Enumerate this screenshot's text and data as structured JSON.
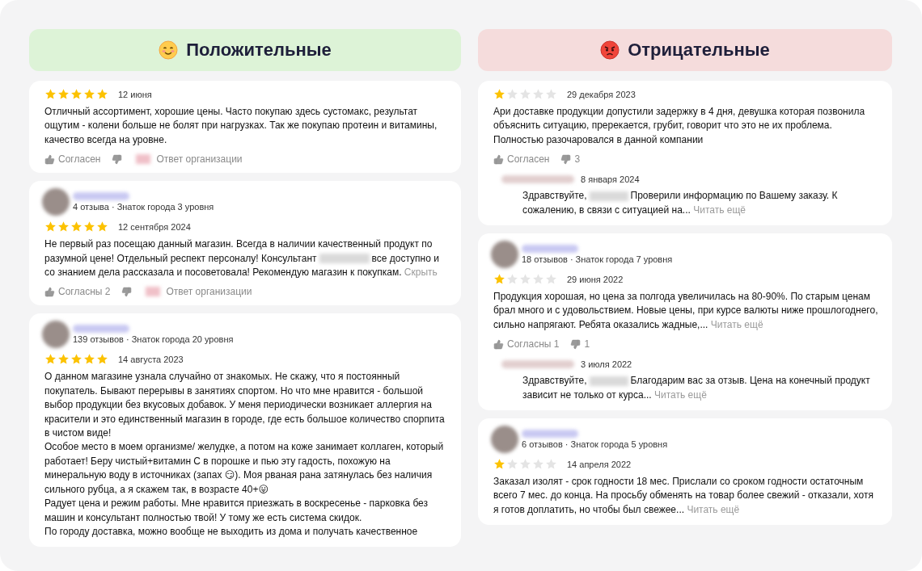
{
  "columns": [
    {
      "kind": "positive",
      "title": "Положительные",
      "reviews": [
        {
          "stars": 5,
          "date": "12 июня",
          "text": [
            "Отличный ассортимент, хорошие цены. Часто покупаю здесь сустомакс, результат ощутим - колени больше не болят при нагрузках. Так же покупаю протеин и витамины, качество всегда на уровне."
          ],
          "likes": "Согласен",
          "org_reply_link": "Ответ организации"
        },
        {
          "author": {
            "meta": "4 отзыва · Знаток города 3 уровня"
          },
          "stars": 5,
          "date": "12 сентября 2024",
          "text": [
            "Не первый раз посещаю данный магазин. Всегда в наличии качественный продукт по разумной цене! Отдельный респект персоналу! Консультант",
            "все доступно и со знанием дела рассказала и посоветовала! Рекомендую магазин к покупкам."
          ],
          "more": "Скрыть",
          "likes": "Согласны 2",
          "org_reply_link": "Ответ организации"
        },
        {
          "author": {
            "meta": "139 отзывов · Знаток города 20 уровня"
          },
          "stars": 5,
          "date": "14 августа 2023",
          "text": [
            "О данном магазине узнала случайно от знакомых. Не скажу, что я постоянный покупатель. Бывают перерывы в занятиях спортом. Но что мне нравится - большой выбор продукции без вкусовых добавок. У меня периодически возникает аллергия на красители и это единственный магазин в городе, где есть большое количество спорпита в чистом виде!\nОсобое место в моем организме/ желудке, а потом на коже занимает коллаген, который работает! Беру чистый+витамин С в порошке и пью эту гадость, похожую на минеральную воду в источниках (запах 😏). Моя рваная рана затянулась без наличия сильного рубца, а я скажем так, в возрасте 40+😛\nРадует цена и режим работы. Мне нравится приезжать в воскресенье - парковка без машин и консультант полностью твой! У тому же есть система скидок.\nПо городу доставка, можно вообще не выходить из дома и получать качественное"
          ]
        }
      ]
    },
    {
      "kind": "negative",
      "title": "Отрицательные",
      "reviews": [
        {
          "stars": 1,
          "date": "29 декабря 2023",
          "text": [
            "Ари доставке продукции допустили задержку в 4 дня, девушка которая позвонила объяснить ситуацию, пререкается, грубит, говорит что это не их проблема. Полностью разочаровался в данной компании"
          ],
          "likes": "Согласен",
          "dislikes": "3",
          "reply": {
            "date": "8 января 2024",
            "text": [
              "Здравствуйте,",
              "Проверили информацию по Вашему заказу. К сожалению, в связи с ситуацией на..."
            ],
            "more": "Читать ещё"
          }
        },
        {
          "author": {
            "meta": "18 отзывов · Знаток города 7 уровня"
          },
          "stars": 1,
          "date": "29 июня 2022",
          "text": [
            "Продукция хорошая, но цена за полгода увеличилась на 80-90%. По старым ценам брал много и с удовольствием. Новые цены, при курсе валюты ниже прошлогоднего, сильно напрягают. Ребята оказались жадные,..."
          ],
          "more": "Читать ещё",
          "likes": "Согласны 1",
          "dislikes": "1",
          "reply": {
            "date": "3 июля 2022",
            "text": [
              "Здравствуйте,",
              "Благодарим вас за отзыв. Цена на конечный продукт зависит не только от курса..."
            ],
            "more": "Читать ещё"
          }
        },
        {
          "author": {
            "meta": "6 отзывов · Знаток города 5 уровня"
          },
          "stars": 1,
          "date": "14 апреля 2022",
          "text": [
            "Заказал изолят - срок годности 18 мес. Прислали со сроком годности остаточным всего 7 мес. до конца. На просьбу обменять на товар более свежий - отказали, хотя я готов доплатить, но чтобы был свежее..."
          ],
          "more": "Читать ещё"
        }
      ]
    }
  ]
}
